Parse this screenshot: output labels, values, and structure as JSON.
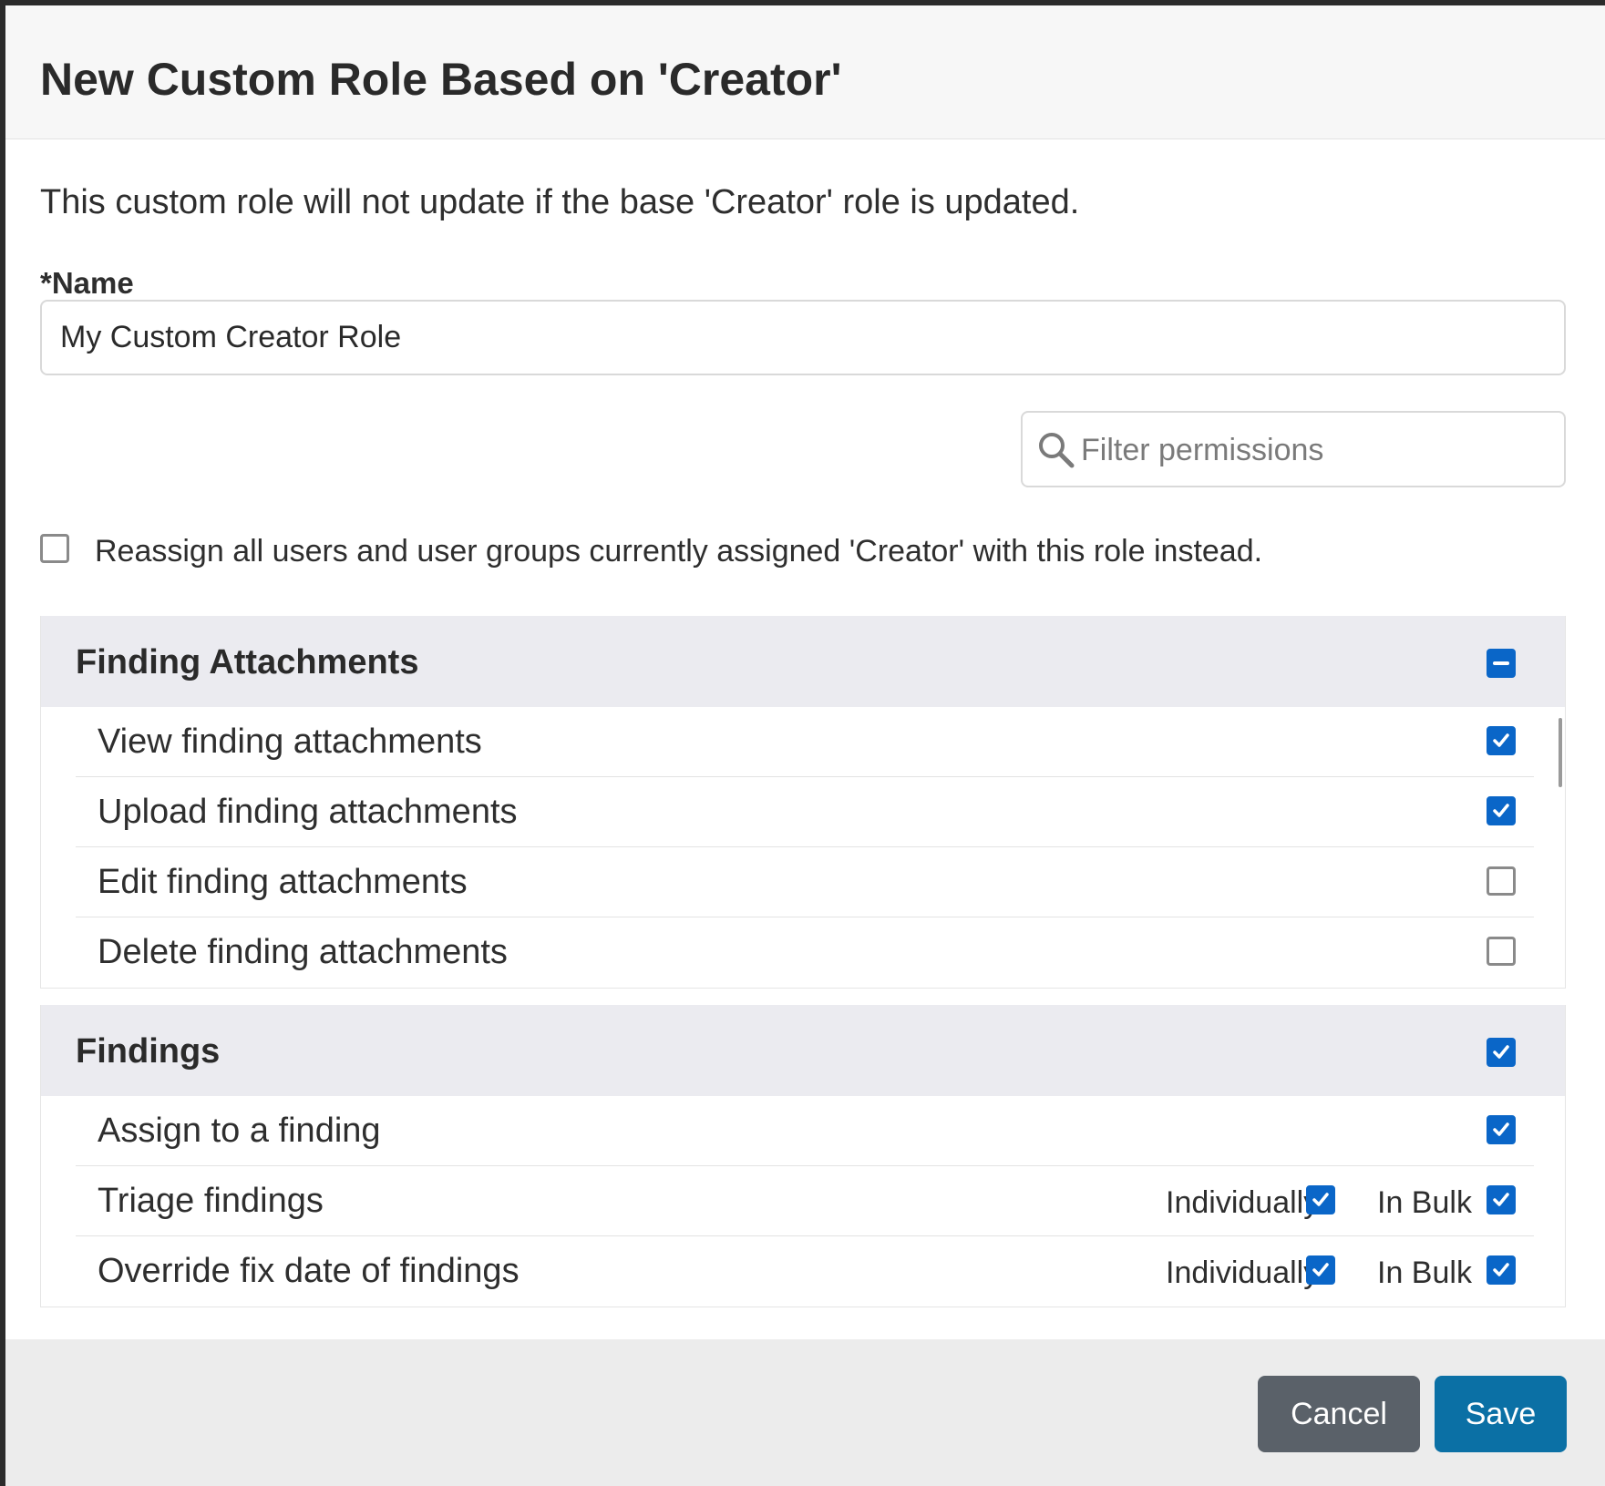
{
  "modal": {
    "title": "New Custom Role Based on 'Creator'",
    "notice": "This custom role will not update if the base 'Creator' role is updated.",
    "name_label": "*Name",
    "name_value": "My Custom Creator Role",
    "filter_placeholder": "Filter permissions",
    "reassign_label": "Reassign all users and user groups currently assigned 'Creator' with this role instead.",
    "reassign_checked": false
  },
  "sections": [
    {
      "title": "Finding Attachments",
      "state": "indeterminate",
      "rows": [
        {
          "label": "View finding attachments",
          "checked": true
        },
        {
          "label": "Upload finding attachments",
          "checked": true
        },
        {
          "label": "Edit finding attachments",
          "checked": false
        },
        {
          "label": "Delete finding attachments",
          "checked": false
        }
      ]
    },
    {
      "title": "Findings",
      "state": "checked",
      "rows": [
        {
          "label": "Assign to a finding",
          "checked": true
        },
        {
          "label": "Triage findings",
          "individually_label": "Individually",
          "individually": true,
          "bulk_label": "In Bulk",
          "bulk": true
        },
        {
          "label": "Override fix date of findings",
          "individually_label": "Individually",
          "individually": true,
          "bulk_label": "In Bulk",
          "bulk": true
        }
      ]
    }
  ],
  "footer": {
    "cancel_label": "Cancel",
    "save_label": "Save"
  },
  "colors": {
    "accent": "#0a66c8",
    "save_button": "#0b70a5",
    "cancel_button": "#5a6169",
    "section_header_bg": "#ebebf0"
  },
  "icons": {
    "search": "search-icon",
    "check": "check-icon",
    "minus": "minus-icon"
  }
}
